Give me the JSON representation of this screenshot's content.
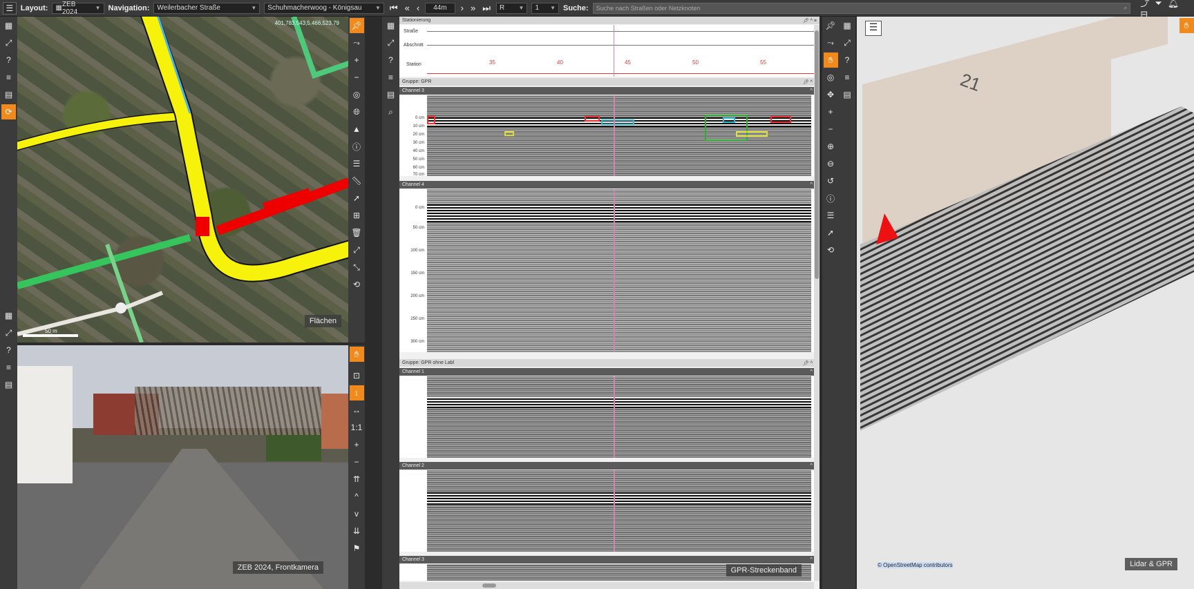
{
  "topbar": {
    "layout_label": "Layout:",
    "layout_value": "ZEB 2024",
    "navigation_label": "Navigation:",
    "nav_street": "Weilerbacher Straße",
    "nav_section": "Schuhmacherwoog - Königsau",
    "step_value": "44m",
    "side_value": "R",
    "lane_value": "1",
    "search_label": "Suche:",
    "search_placeholder": "Suche nach Straßen oder Netzknoten"
  },
  "map": {
    "label": "Flächen",
    "scale": "50 m",
    "coords": "401,783.543,5.466,523.79"
  },
  "street_view": {
    "label": "ZEB 2024, Frontkamera"
  },
  "gpr": {
    "label": "GPR-Streckenband",
    "stationierung": "Stationierung",
    "row_strasse": "Straße",
    "row_abschnitt": "Abschnitt",
    "row_station": "Station",
    "station_ticks": [
      "35",
      "40",
      "45",
      "50",
      "55"
    ],
    "group1": "Gruppe: GPR",
    "group2": "Gruppe: GPR ohne Labl",
    "channel3": "Channel 3",
    "channel4": "Channel 4",
    "channel1": "Channel 1",
    "channel2": "Channel 2",
    "channel3b": "Channel 3",
    "depths_small": [
      "0 cm",
      "10 cm",
      "20 cm",
      "30 cm",
      "40 cm",
      "50 cm",
      "60 cm",
      "70 cm"
    ],
    "depths_large": [
      "0 cm",
      "50 cm",
      "100 cm",
      "150 cm",
      "200 cm",
      "250 cm",
      "300 cm"
    ]
  },
  "lidar": {
    "label": "Lidar & GPR",
    "building_no": "21",
    "osm_link": "© OpenStreetMap contributors"
  }
}
